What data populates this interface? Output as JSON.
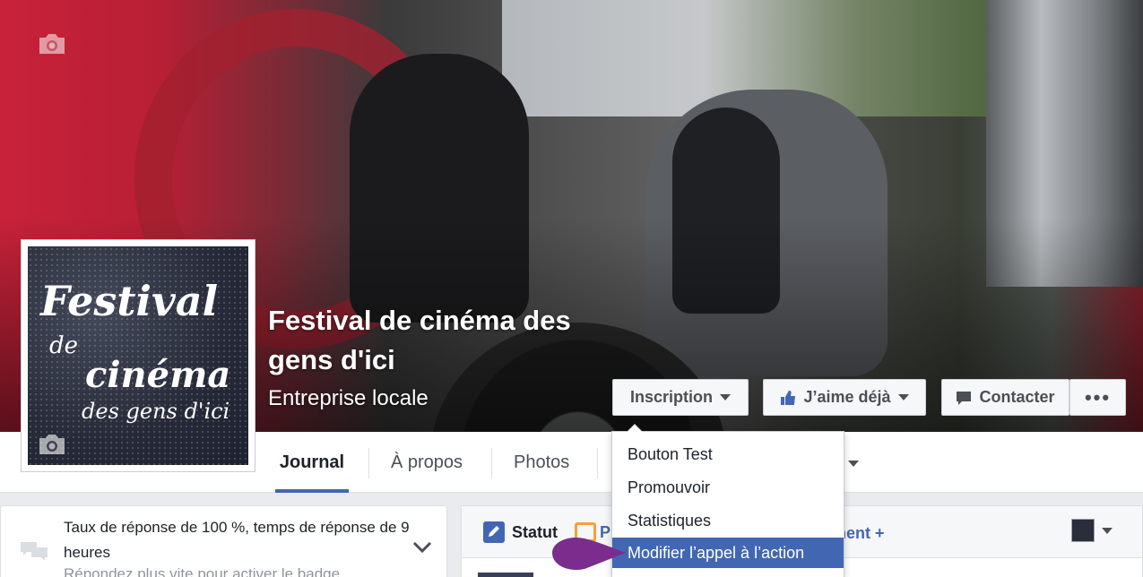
{
  "page": {
    "name": "Festival de cinéma des gens d'ici",
    "category": "Entreprise locale"
  },
  "logo": {
    "line1": "Festival",
    "line2": "de",
    "line3": "cinéma",
    "line4": "des gens d'ici"
  },
  "actions": {
    "inscription": "Inscription",
    "like": "J’aime déjà",
    "contact": "Contacter",
    "more": "•••"
  },
  "tabs": [
    {
      "label": "Journal",
      "active": true
    },
    {
      "label": "À propos",
      "active": false
    },
    {
      "label": "Photos",
      "active": false
    }
  ],
  "dropdown": {
    "items": [
      {
        "label": "Bouton Test"
      },
      {
        "label": "Promouvoir"
      },
      {
        "label": "Statistiques"
      },
      {
        "label": "Modifier l’appel à l’action",
        "highlighted": true
      }
    ]
  },
  "response_card": {
    "text": "Taux de réponse de 100 %, temps de réponse de 9 heures",
    "sub": "Répondez plus vite pour activer le badge"
  },
  "composer": {
    "status": "Statut",
    "photo_partial": "P",
    "event_partial": "ment +"
  },
  "colors": {
    "brand": "#4267b2",
    "pointer": "#7b2d8e"
  },
  "icons": [
    "camera-icon",
    "thumbs-up-icon",
    "message-icon",
    "chat-bubbles-icon",
    "chevron-down-icon",
    "pencil-icon",
    "photo-icon"
  ]
}
